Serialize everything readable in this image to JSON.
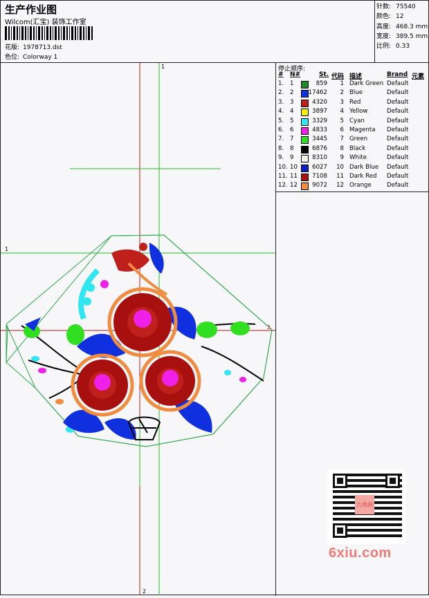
{
  "header": {
    "title": "生产作业图",
    "company": "Wilcom(汇宝) 装饰工作室",
    "fields": [
      {
        "label": "花版:",
        "value": "1978713.dst"
      },
      {
        "label": "色位:",
        "value": "Colorway 1"
      }
    ]
  },
  "stats": [
    {
      "label": "针数:",
      "value": "75540"
    },
    {
      "label": "颜色:",
      "value": "12"
    },
    {
      "label": "高度:",
      "value": "468.3 mm"
    },
    {
      "label": "宽度:",
      "value": "389.5 mm"
    },
    {
      "label": "比例:",
      "value": "0.33"
    }
  ],
  "stop_sequence": {
    "title": "停止顺序:",
    "headers": {
      "hash": "#",
      "n": "N#",
      "st": "St.",
      "code": "代码",
      "desc": "描述",
      "brand": "Brand",
      "elem": "元素"
    },
    "rows": [
      {
        "hash": "1.",
        "n": "1",
        "color": "#1a8a2a",
        "st": "859",
        "code": "1",
        "desc": "Dark Green",
        "brand": "Default"
      },
      {
        "hash": "2.",
        "n": "2",
        "color": "#1030e0",
        "st": "17462",
        "code": "2",
        "desc": "Blue",
        "brand": "Default"
      },
      {
        "hash": "3.",
        "n": "3",
        "color": "#c0201c",
        "st": "4320",
        "code": "3",
        "desc": "Red",
        "brand": "Default"
      },
      {
        "hash": "4.",
        "n": "4",
        "color": "#f5f000",
        "st": "3897",
        "code": "4",
        "desc": "Yellow",
        "brand": "Default"
      },
      {
        "hash": "5.",
        "n": "5",
        "color": "#30e6f0",
        "st": "3329",
        "code": "5",
        "desc": "Cyan",
        "brand": "Default"
      },
      {
        "hash": "6.",
        "n": "6",
        "color": "#f020e8",
        "st": "4833",
        "code": "6",
        "desc": "Magenta",
        "brand": "Default"
      },
      {
        "hash": "7.",
        "n": "7",
        "color": "#30e020",
        "st": "3445",
        "code": "7",
        "desc": "Green",
        "brand": "Default"
      },
      {
        "hash": "8.",
        "n": "8",
        "color": "#000000",
        "st": "6876",
        "code": "8",
        "desc": "Black",
        "brand": "Default"
      },
      {
        "hash": "9.",
        "n": "9",
        "color": "#f2f2ea",
        "st": "8310",
        "code": "9",
        "desc": "White",
        "brand": "Default"
      },
      {
        "hash": "10.",
        "n": "10",
        "color": "#1020c8",
        "st": "6027",
        "code": "10",
        "desc": "Dark Blue",
        "brand": "Default"
      },
      {
        "hash": "11.",
        "n": "11",
        "color": "#a81010",
        "st": "7108",
        "code": "11",
        "desc": "Dark Red",
        "brand": "Default"
      },
      {
        "hash": "12.",
        "n": "12",
        "color": "#f08c40",
        "st": "9072",
        "code": "12",
        "desc": "Orange",
        "brand": "Default"
      }
    ]
  },
  "guides": {
    "top": "1",
    "left": "1",
    "right": "2",
    "bottom": "2"
  },
  "watermark": {
    "logo_text": "6xiu.com",
    "seal_text": "六秀网"
  },
  "colors": {
    "guide_green": "#22c122",
    "guide_red": "#c01818",
    "outline": "#2aa84a"
  }
}
